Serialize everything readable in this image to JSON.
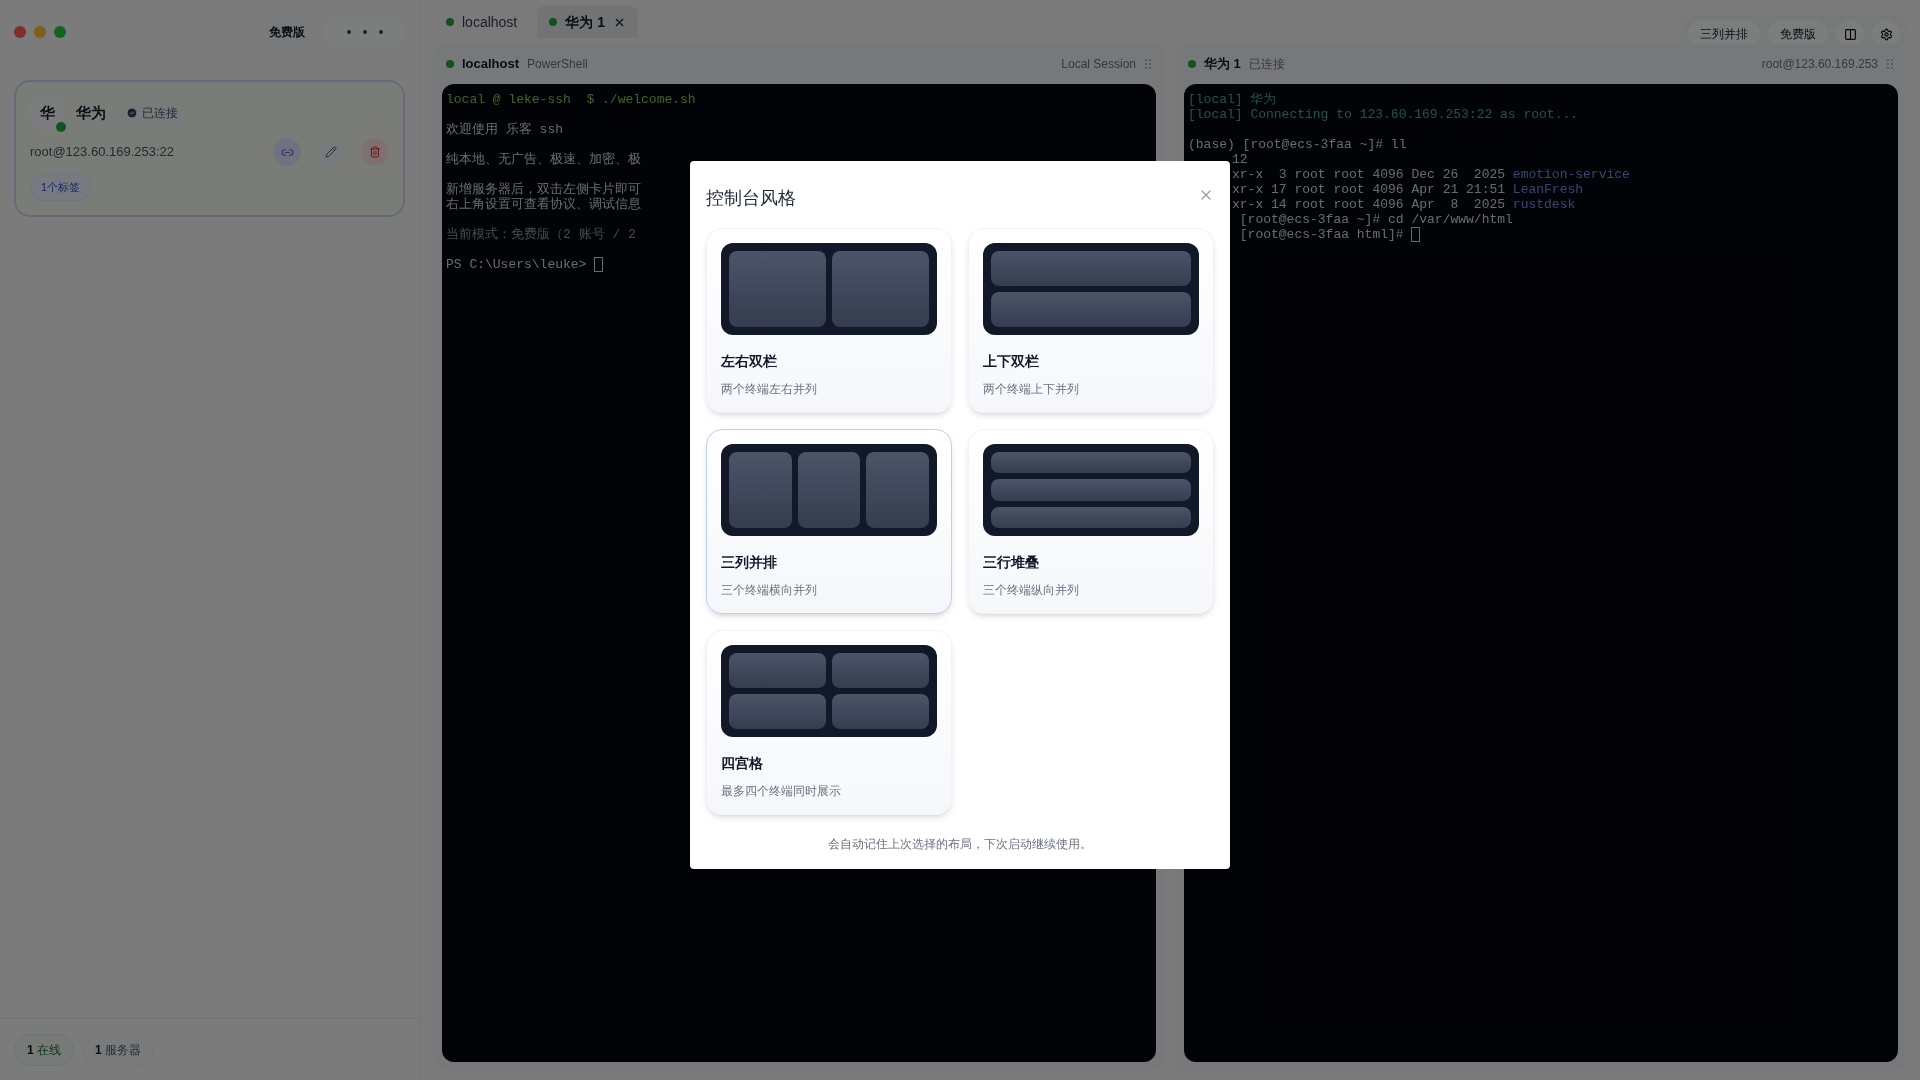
{
  "sidebar": {
    "plan_badge": "免费版",
    "server_card": {
      "avatar": "华",
      "name": "华为",
      "status": "已连接",
      "online": true,
      "address": "root@123.60.169.253:22",
      "tag_count": "1个标签"
    },
    "stats": [
      {
        "value": "1",
        "label": "在线",
        "kind": "online"
      },
      {
        "value": "1",
        "label": "服务器",
        "kind": "total"
      }
    ]
  },
  "tabs": [
    {
      "label": "localhost",
      "selected": false,
      "closable": false
    },
    {
      "label": "华为 1",
      "selected": true,
      "closable": true
    }
  ],
  "toolbar": {
    "layout_button": "三列并排",
    "plan_button": "免费版"
  },
  "panes": [
    {
      "title": "localhost",
      "subtitle": "PowerShell",
      "right_label": "Local Session",
      "lines": [
        {
          "kind": "prompt",
          "text": "local @ leke-ssh  $ ./welcome.sh"
        },
        {
          "kind": "blank"
        },
        {
          "kind": "plain",
          "text": "欢迎使用 乐客 ssh"
        },
        {
          "kind": "blank"
        },
        {
          "kind": "plain",
          "text": "纯本地、无广告、极速、加密、极"
        },
        {
          "kind": "blank"
        },
        {
          "kind": "plain",
          "text": "新增服务器后，双击左侧卡片即可"
        },
        {
          "kind": "plain",
          "text": "右上角设置可查看协议、调试信息"
        },
        {
          "kind": "blank"
        },
        {
          "kind": "dim",
          "text": "当前模式：免费版（2 账号 / 2"
        },
        {
          "kind": "blank"
        },
        {
          "kind": "plain",
          "text": "PS C:\\Users\\leuke> ",
          "cursor": true
        }
      ]
    },
    {
      "title": "华为 1",
      "subtitle": "已连接",
      "right_label": "root@123.60.169.253",
      "lines": [
        {
          "kind": "info",
          "text": "[local] 华为"
        },
        {
          "kind": "info",
          "text": "[local] Connecting to 123.60.169.253:22 as root..."
        },
        {
          "kind": "blank"
        },
        {
          "kind": "plain",
          "text": "(base) [root@ecs-3faa ~]# ll"
        },
        {
          "kind": "plain",
          "clipped": true,
          "text": "12"
        },
        {
          "kind": "plain",
          "clipped": true,
          "text": "xr-x  3 root root 4096 Dec 26  2025 ",
          "link": "emotion-service"
        },
        {
          "kind": "plain",
          "clipped": true,
          "text": "xr-x 17 root root 4096 Apr 21 21:51 ",
          "link": "LeanFresh"
        },
        {
          "kind": "plain",
          "clipped": true,
          "text": "xr-x 14 root root 4096 Apr  8  2025 ",
          "link": "rustdesk"
        },
        {
          "kind": "plain",
          "clipped": true,
          "text": " [root@ecs-3faa ~]# cd /var/www/html"
        },
        {
          "kind": "plain",
          "clipped": true,
          "text": " [root@ecs-3faa html]# ",
          "cursor": true
        }
      ]
    }
  ],
  "modal": {
    "title": "控制台风格",
    "options": [
      {
        "kind": "columns-2",
        "label": "左右双栏",
        "description": "两个终端左右并列",
        "selected": false
      },
      {
        "kind": "rows-2",
        "label": "上下双栏",
        "description": "两个终端上下并列",
        "selected": false
      },
      {
        "kind": "columns-3",
        "label": "三列并排",
        "description": "三个终端横向并列",
        "selected": true
      },
      {
        "kind": "rows-3",
        "label": "三行堆叠",
        "description": "三个终端纵向并列",
        "selected": false
      },
      {
        "kind": "grid-4",
        "label": "四宫格",
        "description": "最多四个终端同时展示",
        "selected": false
      }
    ],
    "footnote": "会自动记住上次选择的布局，下次启动继续使用。"
  }
}
